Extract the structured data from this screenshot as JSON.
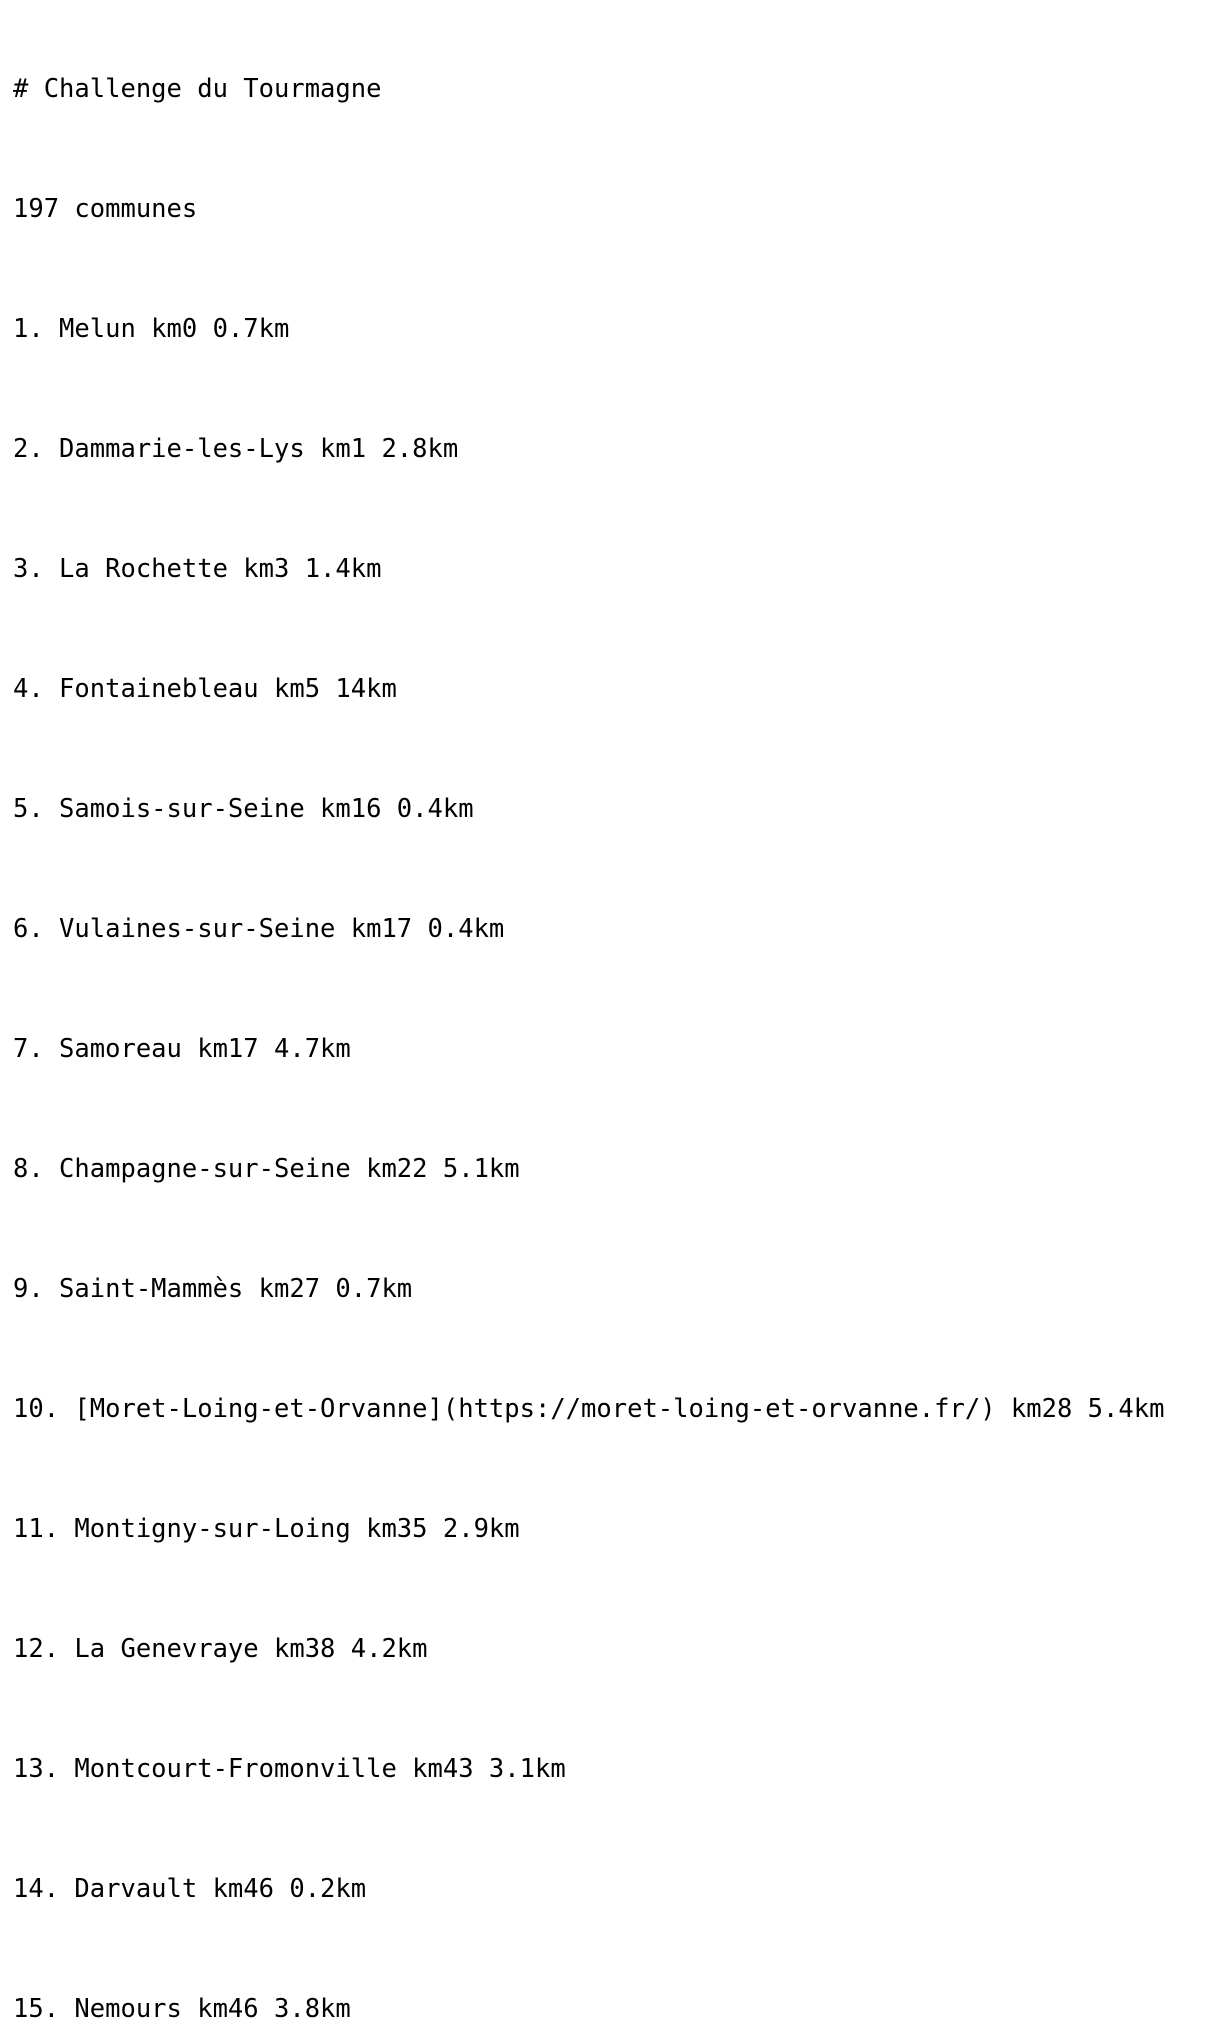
{
  "document": {
    "heading": "# Challenge du Tourmagne",
    "count": "197 communes",
    "items": [
      "1. Melun km0 0.7km",
      "2. Dammarie-les-Lys km1 2.8km",
      "3. La Rochette km3 1.4km",
      "4. Fontainebleau km5 14km",
      "5. Samois-sur-Seine km16 0.4km",
      "6. Vulaines-sur-Seine km17 0.4km",
      "7. Samoreau km17 4.7km",
      "8. Champagne-sur-Seine km22 5.1km",
      "9. Saint-Mammès km27 0.7km",
      "10. [Moret-Loing-et-Orvanne](https://moret-loing-et-orvanne.fr/) km28 5.4km",
      "11. Montigny-sur-Loing km35 2.9km",
      "12. La Genevraye km38 4.2km",
      "13. Montcourt-Fromonville km43 3.1km",
      "14. Darvault km46 0.2km",
      "15. Nemours km46 3.8km"
    ]
  }
}
